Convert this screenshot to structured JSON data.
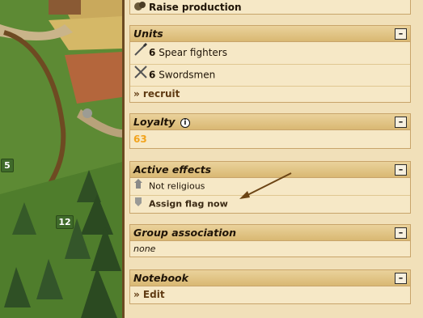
{
  "map": {
    "markers": [
      "5",
      "12"
    ]
  },
  "production": {
    "label": "Raise production",
    "icon": "raise-production-icon"
  },
  "units": {
    "title": "Units",
    "items": [
      {
        "count": "6",
        "label": "Spear fighters",
        "icon": "spear-icon"
      },
      {
        "count": "6",
        "label": "Swordsmen",
        "icon": "crossed-swords-icon"
      }
    ],
    "recruit": "» recruit"
  },
  "loyalty": {
    "title": "Loyalty",
    "value": "63"
  },
  "effects": {
    "title": "Active effects",
    "items": [
      {
        "label": "Not religious",
        "icon": "church-icon"
      },
      {
        "label": "Assign flag now",
        "icon": "flag-icon"
      }
    ]
  },
  "group": {
    "title": "Group association",
    "value": "none"
  },
  "notebook": {
    "title": "Notebook",
    "edit": "» Edit"
  },
  "colors": {
    "accent_orange": "#f2a31c",
    "link_brown": "#603b13",
    "header_gold": "#d9b873"
  }
}
